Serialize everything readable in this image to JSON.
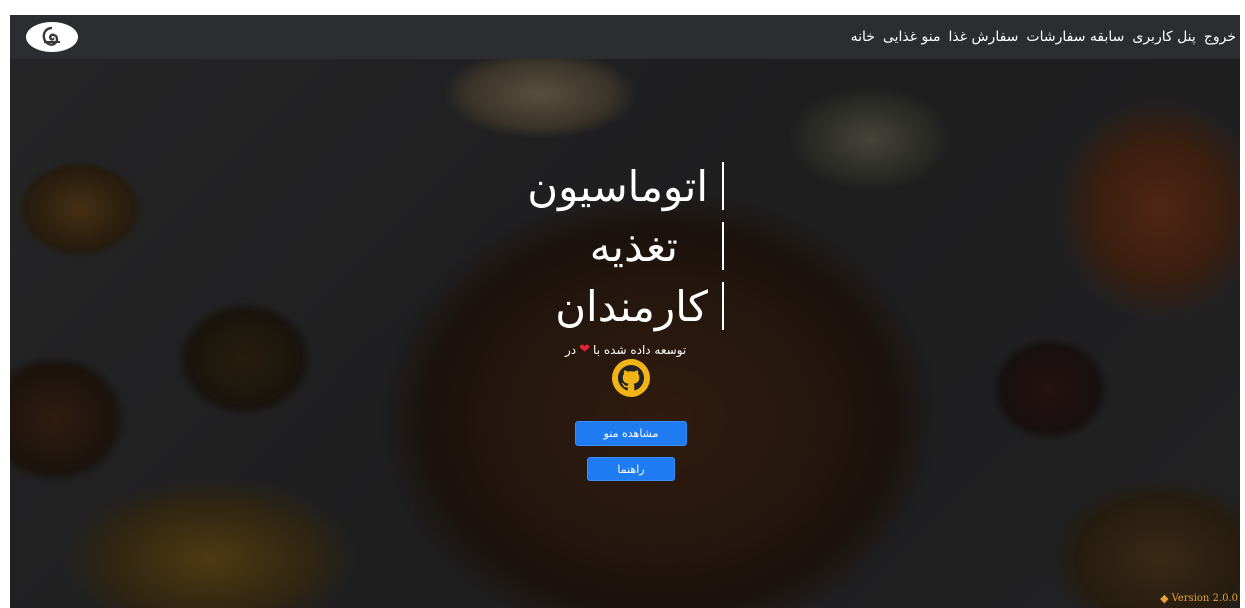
{
  "navbar": {
    "logo_icon": "nautilus-logo-icon",
    "links": [
      "خانه",
      "منو غذایی",
      "سفارش غذا",
      "سابقه سفارشات",
      "پنل کاربری",
      "خروج"
    ]
  },
  "hero": {
    "title_lines": [
      "اتوماسیون",
      "تغذیه",
      "کارمندان"
    ],
    "subtitle_prefix": "توسعه داده شده با",
    "subtitle_suffix": "در",
    "heart_icon": "❤",
    "github_icon": "github-icon",
    "buttons": {
      "view_menu": "مشاهده منو",
      "guide": "راهنما"
    },
    "version": "Version 2.0.0"
  },
  "colors": {
    "navbar": "#2b2d30",
    "button": "#1e7bf2",
    "github": "#f2b316",
    "heart": "#e0243a",
    "version": "#e8a13a"
  }
}
